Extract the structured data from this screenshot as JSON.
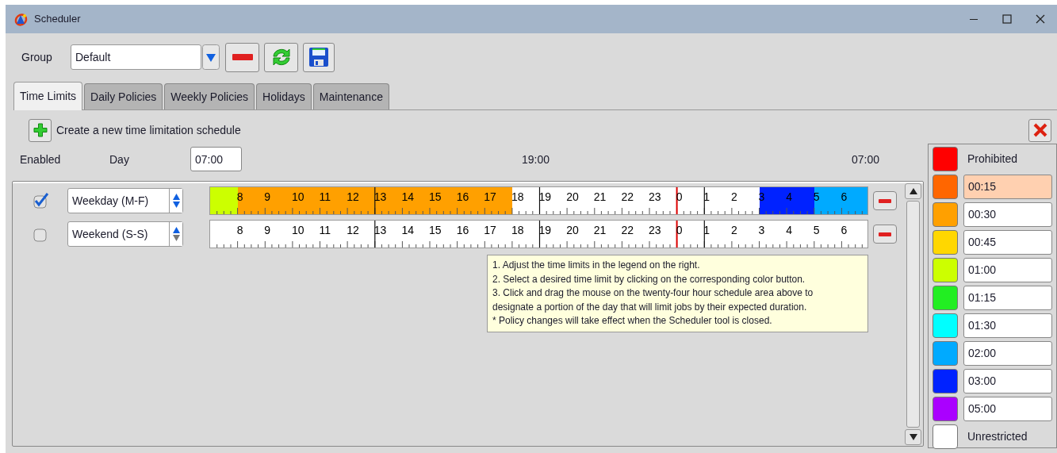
{
  "window": {
    "title": "Scheduler"
  },
  "group": {
    "label": "Group",
    "value": "Default"
  },
  "tabs": [
    {
      "label": "Time Limits",
      "selected": true
    },
    {
      "label": "Daily Policies",
      "selected": false
    },
    {
      "label": "Weekly Policies",
      "selected": false
    },
    {
      "label": "Holidays",
      "selected": false
    },
    {
      "label": "Maintenance",
      "selected": false
    }
  ],
  "create_label": "Create a new time limitation schedule",
  "header": {
    "enabled": "Enabled",
    "day": "Day",
    "start_time": "07:00",
    "mid_time": "19:00",
    "end_time": "07:00"
  },
  "schedules": [
    {
      "enabled": true,
      "day": "Weekday (M-F)",
      "hour_labels": [
        "8",
        "9",
        "10",
        "11",
        "12",
        "13",
        "14",
        "15",
        "16",
        "17",
        "18",
        "19",
        "20",
        "21",
        "22",
        "23",
        "0",
        "1",
        "2",
        "3",
        "4",
        "5",
        "6"
      ],
      "slots": [
        {
          "color": "#ccff00"
        },
        {
          "color": "#ffa000"
        },
        {
          "color": "#ffa000"
        },
        {
          "color": "#ffa000"
        },
        {
          "color": "#ffa000"
        },
        {
          "color": "#ffa000"
        },
        {
          "color": "#ffa000"
        },
        {
          "color": "#ffa000"
        },
        {
          "color": "#ffa000"
        },
        {
          "color": "#ffa000"
        },
        {
          "color": "#ffa000"
        },
        {
          "color": "#ffffff"
        },
        {
          "color": "#ffffff"
        },
        {
          "color": "#ffffff"
        },
        {
          "color": "#ffffff"
        },
        {
          "color": "#ffffff"
        },
        {
          "color": "#ffffff"
        },
        {
          "color": "#ffffff"
        },
        {
          "color": "#ffffff"
        },
        {
          "color": "#ffffff"
        },
        {
          "color": "#0022ff"
        },
        {
          "color": "#0022ff"
        },
        {
          "color": "#00aaff"
        },
        {
          "color": "#00aaff"
        }
      ]
    },
    {
      "enabled": false,
      "day": "Weekend (S-S)",
      "hour_labels": [
        "8",
        "9",
        "10",
        "11",
        "12",
        "13",
        "14",
        "15",
        "16",
        "17",
        "18",
        "19",
        "20",
        "21",
        "22",
        "23",
        "0",
        "1",
        "2",
        "3",
        "4",
        "5",
        "6"
      ],
      "slots": [
        {
          "color": "#ffffff"
        },
        {
          "color": "#ffffff"
        },
        {
          "color": "#ffffff"
        },
        {
          "color": "#ffffff"
        },
        {
          "color": "#ffffff"
        },
        {
          "color": "#ffffff"
        },
        {
          "color": "#ffffff"
        },
        {
          "color": "#ffffff"
        },
        {
          "color": "#ffffff"
        },
        {
          "color": "#ffffff"
        },
        {
          "color": "#ffffff"
        },
        {
          "color": "#ffffff"
        },
        {
          "color": "#ffffff"
        },
        {
          "color": "#ffffff"
        },
        {
          "color": "#ffffff"
        },
        {
          "color": "#ffffff"
        },
        {
          "color": "#ffffff"
        },
        {
          "color": "#ffffff"
        },
        {
          "color": "#ffffff"
        },
        {
          "color": "#ffffff"
        },
        {
          "color": "#ffffff"
        },
        {
          "color": "#ffffff"
        },
        {
          "color": "#ffffff"
        },
        {
          "color": "#ffffff"
        }
      ]
    }
  ],
  "help_lines": [
    "1. Adjust the time limits in the legend on the right.",
    "2. Select a desired time limit by clicking on the corresponding color button.",
    "3. Click and drag the mouse on the twenty-four hour schedule area above to",
    "designate a portion of the day that will limit jobs by their expected duration.",
    "* Policy changes will take effect when the Scheduler tool is closed."
  ],
  "legend": [
    {
      "kind": "label",
      "text": "Prohibited",
      "color": "#ff0000",
      "selected": false
    },
    {
      "kind": "field",
      "text": "00:15",
      "color": "#ff6600",
      "selected": true
    },
    {
      "kind": "field",
      "text": "00:30",
      "color": "#ffa000",
      "selected": false
    },
    {
      "kind": "field",
      "text": "00:45",
      "color": "#ffd700",
      "selected": false
    },
    {
      "kind": "field",
      "text": "01:00",
      "color": "#ccff00",
      "selected": false
    },
    {
      "kind": "field",
      "text": "01:15",
      "color": "#22ee22",
      "selected": false
    },
    {
      "kind": "field",
      "text": "01:30",
      "color": "#00ffff",
      "selected": false
    },
    {
      "kind": "field",
      "text": "02:00",
      "color": "#00aaff",
      "selected": false
    },
    {
      "kind": "field",
      "text": "03:00",
      "color": "#0022ff",
      "selected": false
    },
    {
      "kind": "field",
      "text": "05:00",
      "color": "#aa00ff",
      "selected": false
    },
    {
      "kind": "label",
      "text": "Unrestricted",
      "color": "#ffffff",
      "selected": false
    }
  ]
}
